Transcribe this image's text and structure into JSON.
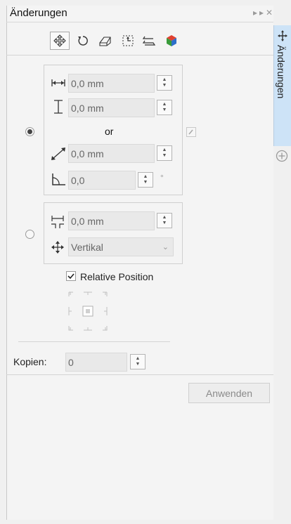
{
  "window": {
    "title": "Änderungen"
  },
  "side_tab": {
    "label": "Änderungen"
  },
  "toolbar": {
    "tools": [
      "position-tool",
      "rotate-tool",
      "skew-tool",
      "scale-tool",
      "mirror-tool",
      "3d-tool"
    ]
  },
  "position_group": {
    "width_value": "0,0 mm",
    "height_value": "0,0 mm",
    "or_label": "or",
    "diagonal_value": "0,0 mm",
    "angle_value": "0,0",
    "angle_unit": "°"
  },
  "offset_group": {
    "spacing_value": "0,0 mm",
    "direction_value": "Vertikal"
  },
  "relative_position": {
    "label": "Relative Position",
    "checked": true
  },
  "copies": {
    "label": "Kopien:",
    "value": "0"
  },
  "apply_button": {
    "label": "Anwenden"
  },
  "colors": {
    "accent": "#cde3f7",
    "panel": "#f4f4f4"
  }
}
